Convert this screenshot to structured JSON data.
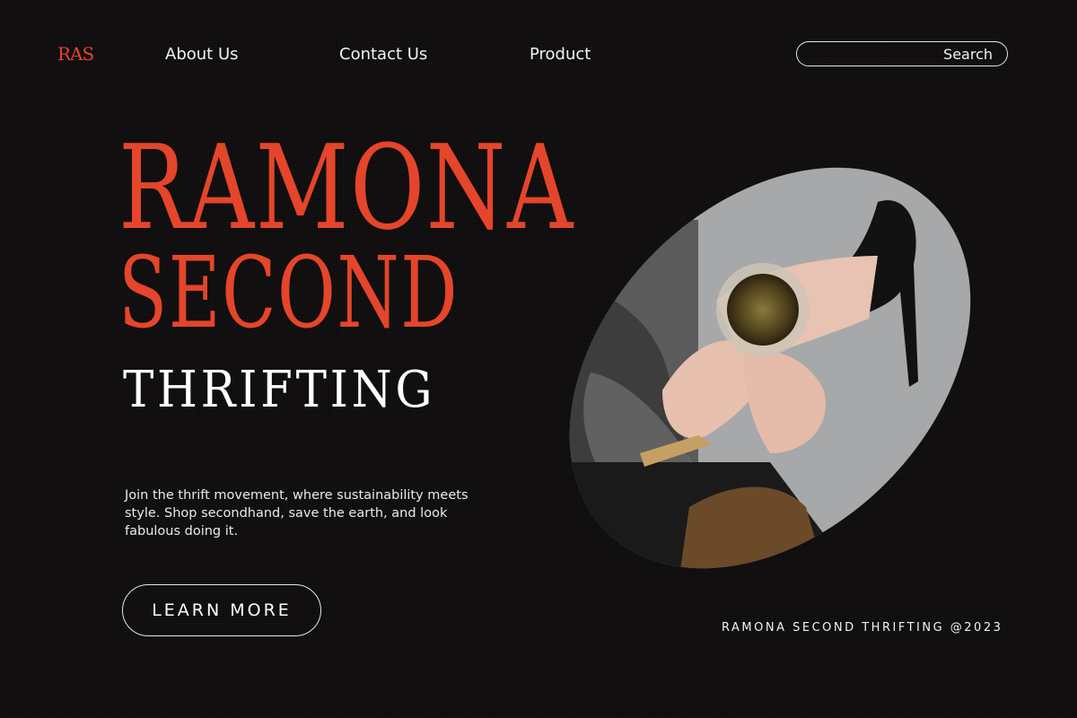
{
  "nav": {
    "logo": "RAS",
    "links": [
      "About Us",
      "Contact Us",
      "Product"
    ],
    "search": {
      "label": "Search",
      "placeholder": ""
    }
  },
  "hero": {
    "line1": "RAMONA",
    "line2": "SECOND",
    "line3": "THRIFTING",
    "description": "Join the thrift movement, where sustainability meets style. Shop secondhand, save the earth, and look fabulous doing it.",
    "cta": "LEARN MORE"
  },
  "footer": {
    "text": "RAMONA SECOND THRIFTING @2023"
  },
  "colors": {
    "accent": "#e5452a",
    "background": "#0f0d0d",
    "text": "#f2f2f2"
  },
  "image": {
    "subject": "oval-photo"
  }
}
